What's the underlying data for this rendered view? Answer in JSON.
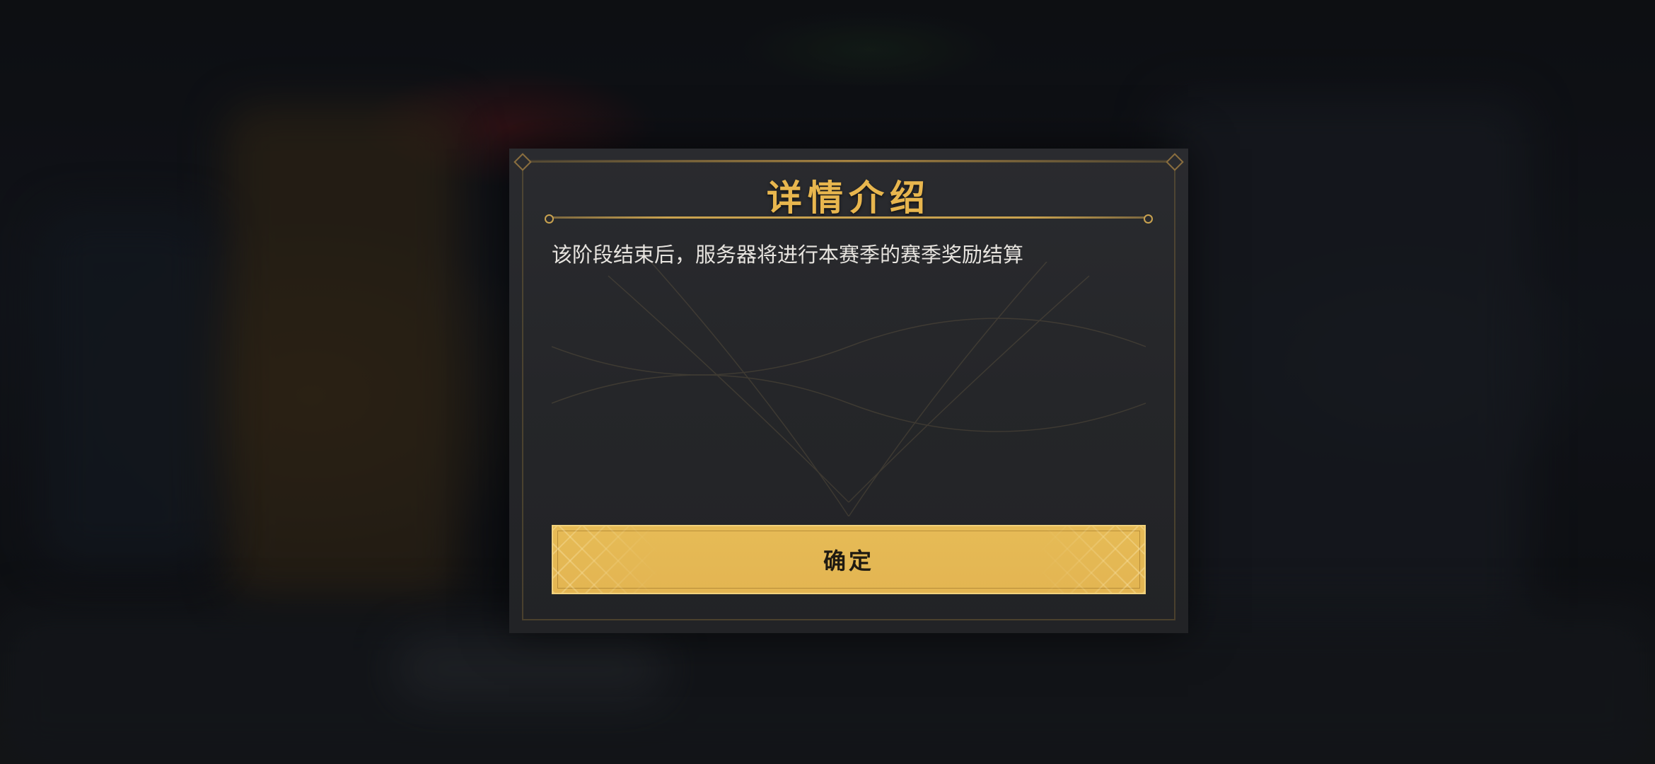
{
  "dialog": {
    "title": "详情介绍",
    "message": "该阶段结束后，服务器将进行本赛季的赛季奖励结算",
    "confirm_label": "确定"
  },
  "colors": {
    "accent_gold": "#e8b64e",
    "button_gold": "#e6bb56",
    "dialog_bg": "#28292c"
  }
}
